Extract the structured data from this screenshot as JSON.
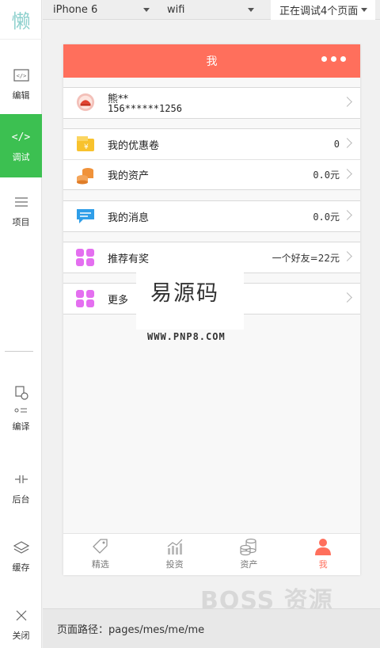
{
  "sidebar": {
    "logo": "懒",
    "items": [
      {
        "label": "编辑",
        "icon": "code-bracket-icon",
        "glyph": "</>",
        "active": false
      },
      {
        "label": "调试",
        "icon": "code-icon",
        "glyph": "</>",
        "active": true
      },
      {
        "label": "项目",
        "icon": "menu-icon",
        "glyph": "☰",
        "active": false
      },
      {
        "label": "编译",
        "icon": "compile-icon",
        "glyph": "⟳",
        "active": false
      },
      {
        "label": "后台",
        "icon": "backend-icon",
        "glyph": "⊣⊢",
        "active": false
      },
      {
        "label": "缓存",
        "icon": "layers-icon",
        "glyph": "≋",
        "active": false
      },
      {
        "label": "关闭",
        "icon": "close-icon",
        "glyph": "✕",
        "active": false
      }
    ]
  },
  "topbar": {
    "device": "iPhone 6",
    "network": "wifi",
    "status": "正在调试4个页面"
  },
  "phone": {
    "title": "我",
    "profile": {
      "name": "熊**",
      "phone": "156******1256"
    },
    "rows": {
      "coupon": {
        "label": "我的优惠卷",
        "value": "0"
      },
      "assets": {
        "label": "我的资产",
        "value": "0.0元"
      },
      "messages": {
        "label": "我的消息",
        "value": "0.0元"
      },
      "referral": {
        "label": "推荐有奖",
        "value": "一个好友=22元"
      },
      "more": {
        "label": "更多"
      }
    },
    "tabs": [
      {
        "label": "精选",
        "icon": "tag-icon"
      },
      {
        "label": "投资",
        "icon": "chart-icon"
      },
      {
        "label": "资产",
        "icon": "coins-icon"
      },
      {
        "label": "我",
        "icon": "user-icon",
        "active": true
      }
    ],
    "accent_color": "#ff6f5c"
  },
  "watermark": {
    "cn": "易源码",
    "url": "WWW.PNP8.COM",
    "brand": "BOSS 资源"
  },
  "pathbar": {
    "text": "页面路径：pages/mes/me/me"
  },
  "colors": {
    "sidebar_active": "#3cc051",
    "navbar": "#ff6f5c"
  }
}
